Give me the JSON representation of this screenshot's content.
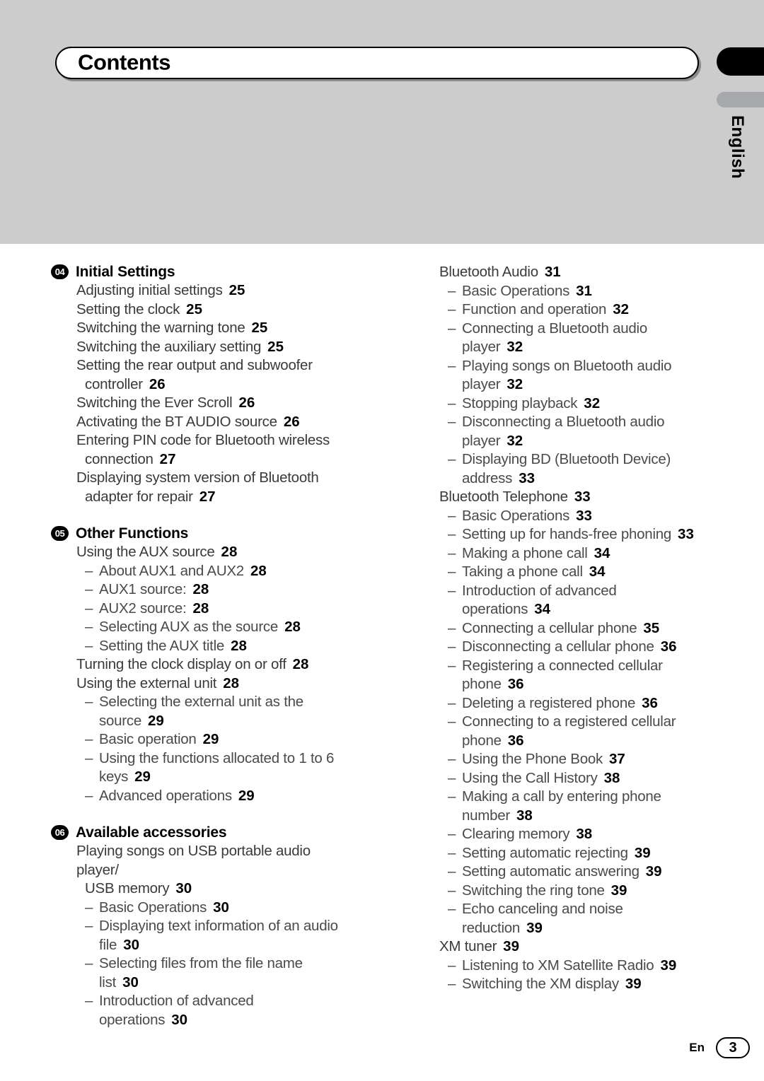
{
  "header": {
    "title": "Contents",
    "side_tab_label": "English"
  },
  "footer": {
    "locale_label": "En",
    "page_number": "3"
  },
  "colors": {
    "band": "#cccccc",
    "tab_black": "#000000",
    "tab_gray": "#a6a8ab",
    "text": "#3a3a3a",
    "page_number": "#000000"
  },
  "columns": {
    "left": [
      {
        "type": "chapter",
        "badge": "04",
        "title": "Initial Settings"
      },
      {
        "type": "entry",
        "lines": [
          "Adjusting initial settings"
        ],
        "page": "25"
      },
      {
        "type": "entry",
        "lines": [
          "Setting the clock"
        ],
        "page": "25"
      },
      {
        "type": "entry",
        "lines": [
          "Switching the warning tone"
        ],
        "page": "25"
      },
      {
        "type": "entry",
        "lines": [
          "Switching the auxiliary setting"
        ],
        "page": "25"
      },
      {
        "type": "entry",
        "lines": [
          "Setting the rear output and subwoofer",
          "controller"
        ],
        "page": "26"
      },
      {
        "type": "entry",
        "lines": [
          "Switching the Ever Scroll"
        ],
        "page": "26"
      },
      {
        "type": "entry",
        "lines": [
          "Activating the BT AUDIO source"
        ],
        "page": "26"
      },
      {
        "type": "entry",
        "lines": [
          "Entering PIN code for Bluetooth wireless",
          "connection"
        ],
        "page": "27"
      },
      {
        "type": "entry",
        "lines": [
          "Displaying system version of Bluetooth",
          "adapter for repair"
        ],
        "page": "27"
      },
      {
        "type": "chapter",
        "badge": "05",
        "title": "Other Functions"
      },
      {
        "type": "entry",
        "lines": [
          "Using the AUX source"
        ],
        "page": "28"
      },
      {
        "type": "sub",
        "lines": [
          "About AUX1 and AUX2"
        ],
        "page": "28"
      },
      {
        "type": "sub",
        "lines": [
          "AUX1 source:"
        ],
        "page": "28"
      },
      {
        "type": "sub",
        "lines": [
          "AUX2 source:"
        ],
        "page": "28"
      },
      {
        "type": "sub",
        "lines": [
          "Selecting AUX as the source"
        ],
        "page": "28"
      },
      {
        "type": "sub",
        "lines": [
          "Setting the AUX title"
        ],
        "page": "28"
      },
      {
        "type": "entry",
        "lines": [
          "Turning the clock display on or off"
        ],
        "page": "28"
      },
      {
        "type": "entry",
        "lines": [
          "Using the external unit"
        ],
        "page": "28"
      },
      {
        "type": "sub",
        "lines": [
          "Selecting the external unit as the",
          "source"
        ],
        "page": "29"
      },
      {
        "type": "sub",
        "lines": [
          "Basic operation"
        ],
        "page": "29"
      },
      {
        "type": "sub",
        "lines": [
          "Using the functions allocated to 1 to 6",
          "keys"
        ],
        "page": "29"
      },
      {
        "type": "sub",
        "lines": [
          "Advanced operations"
        ],
        "page": "29"
      },
      {
        "type": "chapter",
        "badge": "06",
        "title": "Available accessories"
      },
      {
        "type": "entry",
        "lines": [
          "Playing songs on USB portable audio player/",
          "USB memory"
        ],
        "page": "30"
      },
      {
        "type": "sub",
        "lines": [
          "Basic Operations"
        ],
        "page": "30"
      },
      {
        "type": "sub",
        "lines": [
          "Displaying text information of an audio",
          "file"
        ],
        "page": "30"
      },
      {
        "type": "sub",
        "lines": [
          "Selecting files from the file name",
          "list"
        ],
        "page": "30"
      },
      {
        "type": "sub",
        "lines": [
          "Introduction of advanced",
          "operations"
        ],
        "page": "30"
      }
    ],
    "right": [
      {
        "type": "entry",
        "lines": [
          "Bluetooth Audio"
        ],
        "page": "31"
      },
      {
        "type": "sub",
        "lines": [
          "Basic Operations"
        ],
        "page": "31"
      },
      {
        "type": "sub",
        "lines": [
          "Function and operation"
        ],
        "page": "32"
      },
      {
        "type": "sub",
        "lines": [
          "Connecting a Bluetooth audio",
          "player"
        ],
        "page": "32"
      },
      {
        "type": "sub",
        "lines": [
          "Playing songs on Bluetooth audio",
          "player"
        ],
        "page": "32"
      },
      {
        "type": "sub",
        "lines": [
          "Stopping playback"
        ],
        "page": "32"
      },
      {
        "type": "sub",
        "lines": [
          "Disconnecting a Bluetooth audio",
          "player"
        ],
        "page": "32"
      },
      {
        "type": "sub",
        "lines": [
          "Displaying BD (Bluetooth Device)",
          "address"
        ],
        "page": "33"
      },
      {
        "type": "entry",
        "lines": [
          "Bluetooth Telephone"
        ],
        "page": "33"
      },
      {
        "type": "sub",
        "lines": [
          "Basic Operations"
        ],
        "page": "33"
      },
      {
        "type": "sub",
        "lines": [
          "Setting up for hands-free phoning"
        ],
        "page": "33"
      },
      {
        "type": "sub",
        "lines": [
          "Making a phone call"
        ],
        "page": "34"
      },
      {
        "type": "sub",
        "lines": [
          "Taking a phone call"
        ],
        "page": "34"
      },
      {
        "type": "sub",
        "lines": [
          "Introduction of advanced",
          "operations"
        ],
        "page": "34"
      },
      {
        "type": "sub",
        "lines": [
          "Connecting a cellular phone"
        ],
        "page": "35"
      },
      {
        "type": "sub",
        "lines": [
          "Disconnecting a cellular phone"
        ],
        "page": "36"
      },
      {
        "type": "sub",
        "lines": [
          "Registering a connected cellular",
          "phone"
        ],
        "page": "36"
      },
      {
        "type": "sub",
        "lines": [
          "Deleting a registered phone"
        ],
        "page": "36"
      },
      {
        "type": "sub",
        "lines": [
          "Connecting to a registered cellular",
          "phone"
        ],
        "page": "36"
      },
      {
        "type": "sub",
        "lines": [
          "Using the Phone Book"
        ],
        "page": "37"
      },
      {
        "type": "sub",
        "lines": [
          "Using the Call History"
        ],
        "page": "38"
      },
      {
        "type": "sub",
        "lines": [
          "Making a call by entering phone",
          "number"
        ],
        "page": "38"
      },
      {
        "type": "sub",
        "lines": [
          "Clearing memory"
        ],
        "page": "38"
      },
      {
        "type": "sub",
        "lines": [
          "Setting automatic rejecting"
        ],
        "page": "39"
      },
      {
        "type": "sub",
        "lines": [
          "Setting automatic answering"
        ],
        "page": "39"
      },
      {
        "type": "sub",
        "lines": [
          "Switching the ring tone"
        ],
        "page": "39"
      },
      {
        "type": "sub",
        "lines": [
          "Echo canceling and noise",
          "reduction"
        ],
        "page": "39"
      },
      {
        "type": "entry",
        "lines": [
          "XM tuner"
        ],
        "page": "39"
      },
      {
        "type": "sub",
        "lines": [
          "Listening to XM Satellite Radio"
        ],
        "page": "39"
      },
      {
        "type": "sub",
        "lines": [
          "Switching the XM display"
        ],
        "page": "39"
      }
    ]
  }
}
